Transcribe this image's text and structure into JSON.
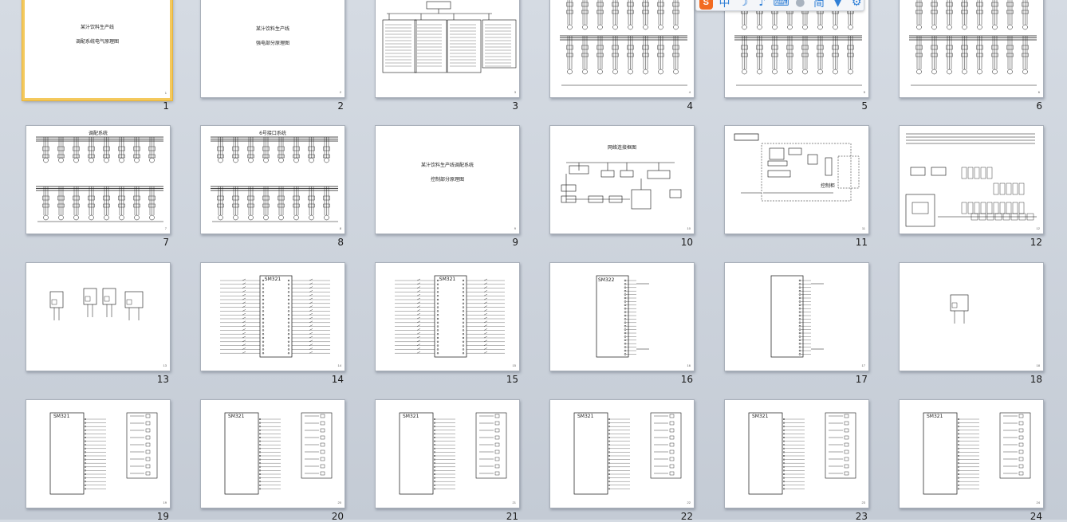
{
  "thumbnail_panel": {
    "slides": [
      {
        "number": "1",
        "kind": "title",
        "lines": [
          "某汁饮料生产线",
          "调配系统电气原理图"
        ],
        "corner": "1",
        "selected": true
      },
      {
        "number": "2",
        "kind": "title",
        "lines": [
          "某汁饮料生产线",
          "强电部分原理图"
        ],
        "corner": "2"
      },
      {
        "number": "3",
        "kind": "tree",
        "header": "配电箱分布图",
        "corner": "3"
      },
      {
        "number": "4",
        "kind": "motors",
        "corner": "4"
      },
      {
        "number": "5",
        "kind": "motors",
        "corner": "5"
      },
      {
        "number": "6",
        "kind": "motors",
        "corner": "6"
      },
      {
        "number": "7",
        "kind": "motors-titled",
        "header": "调配系统",
        "corner": "7"
      },
      {
        "number": "8",
        "kind": "motors-titled",
        "header": "6号接口系统",
        "corner": "8"
      },
      {
        "number": "9",
        "kind": "title",
        "lines": [
          "某汁饮料生产线调配系统",
          "控制部分原理图"
        ],
        "corner": "9"
      },
      {
        "number": "10",
        "kind": "network",
        "header": "网络连接框图",
        "corner": "10"
      },
      {
        "number": "11",
        "kind": "cabinet",
        "caption": "控制柜",
        "corner": "11"
      },
      {
        "number": "12",
        "kind": "wiring",
        "corner": "12"
      },
      {
        "number": "13",
        "kind": "psu",
        "corner": "13"
      },
      {
        "number": "14",
        "kind": "plc",
        "module": "SM321",
        "corner": "14"
      },
      {
        "number": "15",
        "kind": "plc",
        "module": "SM321",
        "corner": "15"
      },
      {
        "number": "16",
        "kind": "plc-narrow",
        "module": "SM322",
        "corner": "16"
      },
      {
        "number": "17",
        "kind": "plc-narrow",
        "corner": "17"
      },
      {
        "number": "18",
        "kind": "psu-single",
        "corner": "18"
      },
      {
        "number": "19",
        "kind": "io",
        "module": "SM321",
        "corner": "19"
      },
      {
        "number": "20",
        "kind": "io",
        "module": "SM321",
        "corner": "20"
      },
      {
        "number": "21",
        "kind": "io",
        "module": "SM321",
        "corner": "21"
      },
      {
        "number": "22",
        "kind": "io",
        "module": "SM321",
        "corner": "22"
      },
      {
        "number": "23",
        "kind": "io",
        "module": "SM321",
        "corner": "23"
      },
      {
        "number": "24",
        "kind": "io",
        "module": "SM321",
        "corner": "24"
      }
    ]
  },
  "ime_toolbar": {
    "logo": "S",
    "items": [
      {
        "name": "chinese-mode",
        "glyph": "中"
      },
      {
        "name": "punctuation",
        "glyph": "☽"
      },
      {
        "name": "voice",
        "glyph": "♪"
      },
      {
        "name": "keyboard",
        "glyph": "⌨"
      },
      {
        "name": "user",
        "glyph": "●"
      },
      {
        "name": "simplified",
        "glyph": "简"
      },
      {
        "name": "skin",
        "glyph": "▼"
      },
      {
        "name": "settings",
        "glyph": "⚙"
      }
    ]
  },
  "colors": {
    "selection": "#f4c95d",
    "background": "#ccd3dc",
    "accent": "#2f7fd6",
    "logo": "#f26b21"
  }
}
